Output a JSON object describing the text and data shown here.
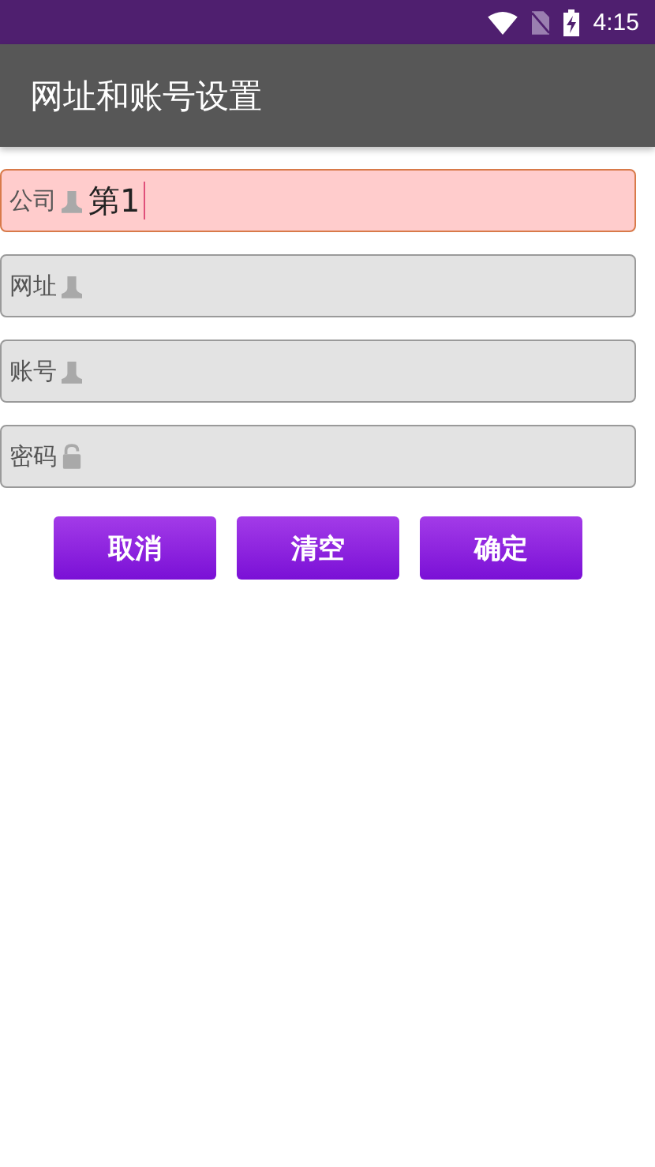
{
  "status_bar": {
    "time": "4:15"
  },
  "app_bar": {
    "title": "网址和账号设置"
  },
  "fields": [
    {
      "label": "公司",
      "kind": "person",
      "value": "第1",
      "focused": true
    },
    {
      "label": "网址",
      "kind": "person",
      "focused": false
    },
    {
      "label": "账号",
      "kind": "person",
      "focused": false
    },
    {
      "label": "密码",
      "kind": "lock",
      "focused": false
    }
  ],
  "buttons": [
    "取消",
    "清空",
    "确定"
  ]
}
